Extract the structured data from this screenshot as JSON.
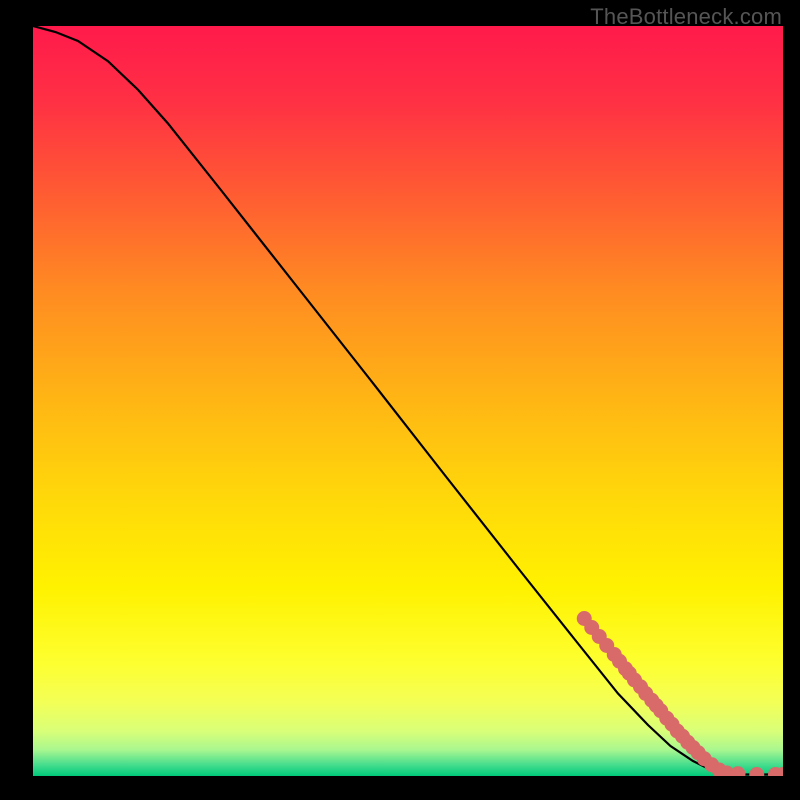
{
  "watermark": "TheBottleneck.com",
  "chart_data": {
    "type": "line",
    "title": "",
    "xlabel": "",
    "ylabel": "",
    "xlim": [
      0,
      100
    ],
    "ylim": [
      0,
      100
    ],
    "grid": false,
    "description": "Decreasing convex curve from top-left to a flat tail at bottom-right over a red→yellow→green vertical gradient; cluster of salmon dots along the lower tail",
    "curve_points": [
      {
        "x": 0,
        "y": 100.0
      },
      {
        "x": 3,
        "y": 99.2
      },
      {
        "x": 6,
        "y": 98.0
      },
      {
        "x": 10,
        "y": 95.3
      },
      {
        "x": 14,
        "y": 91.5
      },
      {
        "x": 18,
        "y": 87.0
      },
      {
        "x": 25,
        "y": 78.2
      },
      {
        "x": 35,
        "y": 65.5
      },
      {
        "x": 45,
        "y": 52.8
      },
      {
        "x": 55,
        "y": 40.0
      },
      {
        "x": 65,
        "y": 27.3
      },
      {
        "x": 72,
        "y": 18.5
      },
      {
        "x": 78,
        "y": 11.0
      },
      {
        "x": 82,
        "y": 6.8
      },
      {
        "x": 85,
        "y": 4.0
      },
      {
        "x": 88,
        "y": 2.0
      },
      {
        "x": 90,
        "y": 1.0
      },
      {
        "x": 92,
        "y": 0.4
      },
      {
        "x": 95,
        "y": 0.2
      },
      {
        "x": 98,
        "y": 0.2
      },
      {
        "x": 100,
        "y": 0.2
      }
    ],
    "markers": [
      {
        "x": 73.5,
        "y": 21.0
      },
      {
        "x": 74.5,
        "y": 19.8
      },
      {
        "x": 75.5,
        "y": 18.6
      },
      {
        "x": 76.5,
        "y": 17.4
      },
      {
        "x": 77.5,
        "y": 16.2
      },
      {
        "x": 78.2,
        "y": 15.3
      },
      {
        "x": 79.0,
        "y": 14.3
      },
      {
        "x": 79.5,
        "y": 13.7
      },
      {
        "x": 80.2,
        "y": 12.8
      },
      {
        "x": 81.0,
        "y": 11.9
      },
      {
        "x": 81.7,
        "y": 11.0
      },
      {
        "x": 82.5,
        "y": 10.1
      },
      {
        "x": 83.1,
        "y": 9.4
      },
      {
        "x": 83.7,
        "y": 8.7
      },
      {
        "x": 84.5,
        "y": 7.7
      },
      {
        "x": 85.2,
        "y": 6.9
      },
      {
        "x": 85.9,
        "y": 6.0
      },
      {
        "x": 86.6,
        "y": 5.3
      },
      {
        "x": 87.3,
        "y": 4.5
      },
      {
        "x": 88.0,
        "y": 3.8
      },
      {
        "x": 88.7,
        "y": 3.1
      },
      {
        "x": 89.5,
        "y": 2.3
      },
      {
        "x": 90.5,
        "y": 1.5
      },
      {
        "x": 91.5,
        "y": 0.8
      },
      {
        "x": 92.5,
        "y": 0.4
      },
      {
        "x": 94.0,
        "y": 0.3
      },
      {
        "x": 96.5,
        "y": 0.2
      },
      {
        "x": 99.0,
        "y": 0.2
      },
      {
        "x": 100.0,
        "y": 0.2
      }
    ],
    "gradient_stops": [
      {
        "offset": 0.0,
        "color": "#ff1a4b"
      },
      {
        "offset": 0.1,
        "color": "#ff3044"
      },
      {
        "offset": 0.22,
        "color": "#ff5a33"
      },
      {
        "offset": 0.35,
        "color": "#ff8a22"
      },
      {
        "offset": 0.5,
        "color": "#ffb614"
      },
      {
        "offset": 0.63,
        "color": "#ffd80a"
      },
      {
        "offset": 0.75,
        "color": "#fff200"
      },
      {
        "offset": 0.85,
        "color": "#fdff30"
      },
      {
        "offset": 0.9,
        "color": "#f4ff55"
      },
      {
        "offset": 0.94,
        "color": "#d9ff78"
      },
      {
        "offset": 0.965,
        "color": "#a9f78f"
      },
      {
        "offset": 0.985,
        "color": "#46dd8e"
      },
      {
        "offset": 1.0,
        "color": "#00c97a"
      }
    ],
    "colors": {
      "curve": "#000000",
      "marker_fill": "#d86a6a",
      "marker_stroke": "#bb4e4e",
      "background": "#000000"
    }
  }
}
